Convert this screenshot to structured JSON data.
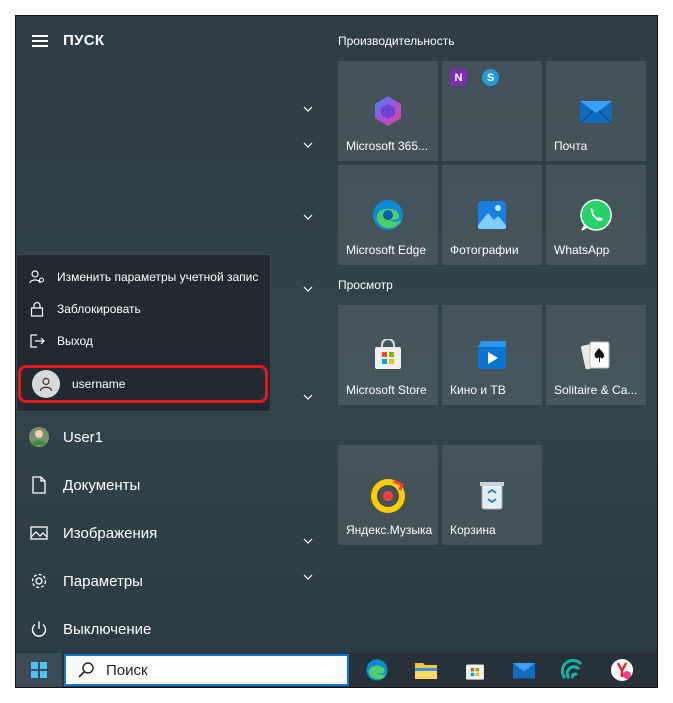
{
  "start": {
    "title": "ПУСК",
    "nav": [
      {
        "label": "User1",
        "icon": "user-avatar-icon"
      },
      {
        "label": "Документы",
        "icon": "document-icon"
      },
      {
        "label": "Изображения",
        "icon": "image-icon"
      },
      {
        "label": "Параметры",
        "icon": "gear-icon"
      },
      {
        "label": "Выключение",
        "icon": "power-icon"
      }
    ],
    "popup": {
      "items": [
        {
          "label": "Изменить параметры учетной запис",
          "icon": "account-settings-icon"
        },
        {
          "label": "Заблокировать",
          "icon": "lock-icon"
        },
        {
          "label": "Выход",
          "icon": "sign-out-icon"
        }
      ],
      "other_user": {
        "label": "username",
        "icon": "user-icon"
      }
    }
  },
  "groups": [
    {
      "label": "Производительность",
      "tiles": [
        {
          "label": "Microsoft 365...",
          "icon": "microsoft-365-icon"
        },
        {
          "label": "",
          "icon": "onenote-skype-icon"
        },
        {
          "label": "Почта",
          "icon": "mail-icon"
        },
        {
          "label": "Microsoft Edge",
          "icon": "edge-icon"
        },
        {
          "label": "Фотографии",
          "icon": "photos-icon"
        },
        {
          "label": "WhatsApp",
          "icon": "whatsapp-icon"
        }
      ]
    },
    {
      "label": "Просмотр",
      "tiles": [
        {
          "label": "Microsoft Store",
          "icon": "store-icon"
        },
        {
          "label": "Кино и ТВ",
          "icon": "movies-tv-icon"
        },
        {
          "label": "Solitaire & Ca...",
          "icon": "solitaire-icon"
        }
      ]
    },
    {
      "label": "",
      "tiles": [
        {
          "label": "Яндекс.Музыка",
          "icon": "yandex-music-icon"
        },
        {
          "label": "Корзина",
          "icon": "recycle-bin-icon"
        }
      ]
    }
  ],
  "taskbar": {
    "search_placeholder": "Поиск",
    "items": [
      "edge-icon",
      "file-explorer-icon",
      "store-icon",
      "mail-icon",
      "app-icon",
      "yandex-browser-icon"
    ]
  },
  "colors": {
    "accent": "#0a78d4",
    "highlight": "#e8161e"
  }
}
